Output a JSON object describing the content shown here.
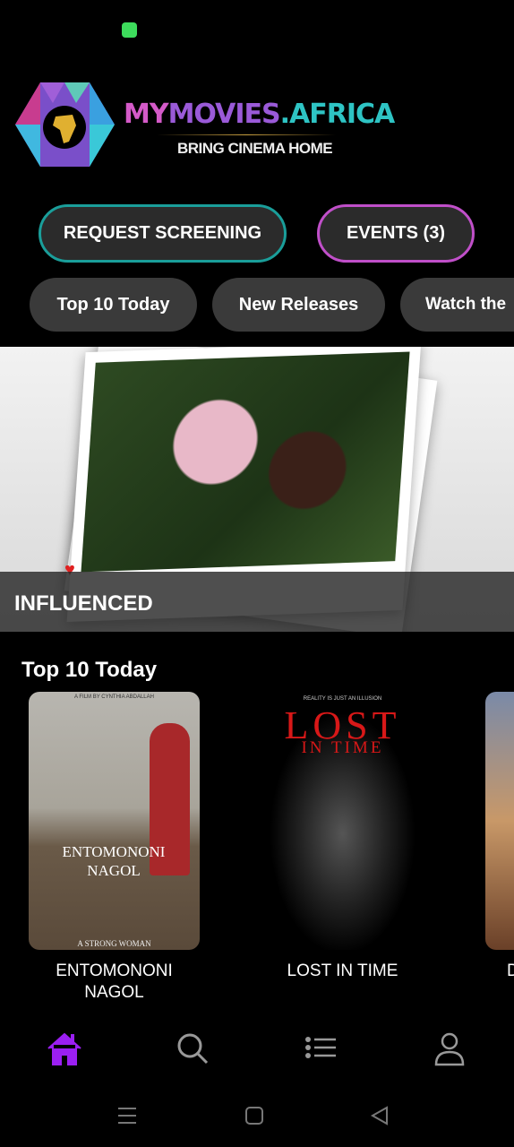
{
  "status_bar": {
    "icon": "messaging-app-icon",
    "color": "#3ddc5c"
  },
  "logo": {
    "part1": "MY",
    "part2": "MOVIES",
    "part3": ".AFRICA",
    "tagline": "BRING CINEMA HOME",
    "tm": "™"
  },
  "actions": {
    "request_screening": "REQUEST SCREENING",
    "events": "EVENTS (3)",
    "request_color": "#1a9e9a",
    "events_color": "#c04fc9"
  },
  "chips": [
    "Top 10 Today",
    "New Releases",
    "Watch the"
  ],
  "hero": {
    "title": "INFLUENCED"
  },
  "section": {
    "title": "Top 10 Today",
    "items": [
      {
        "title": "ENTOMONONI NAGOL",
        "poster_text": "ENTOMONONI NAGOL",
        "poster_top": "A FILM BY CYNTHIA ABDALLAH",
        "poster_bottom": "A STRONG WOMAN"
      },
      {
        "title": "LOST IN TIME",
        "poster_text": "LOST",
        "poster_sub": "IN TIME",
        "poster_top": "REALITY IS JUST AN ILLUSION"
      },
      {
        "title": "D"
      }
    ]
  },
  "bottom_nav": {
    "active_color": "#9b1ff2",
    "items": [
      "home-icon",
      "search-icon",
      "list-icon",
      "profile-icon"
    ]
  },
  "system_nav": [
    "recents-icon",
    "home-square-icon",
    "back-icon"
  ]
}
